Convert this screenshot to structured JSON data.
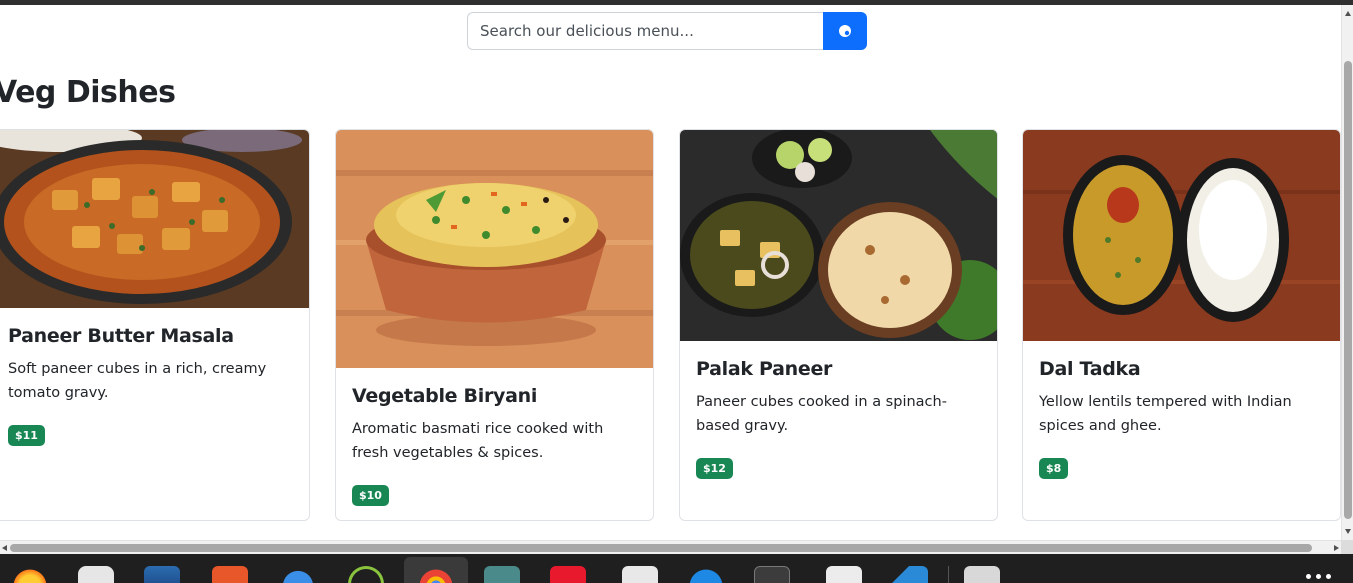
{
  "search": {
    "placeholder": "Search our delicious menu...",
    "button_icon": "search-icon"
  },
  "section": {
    "title": "Veg Dishes"
  },
  "dishes": [
    {
      "name": "Paneer Butter Masala",
      "description": "Soft paneer cubes in a rich, creamy tomato gravy.",
      "price": "$11",
      "image": "paneer-butter-masala-photo"
    },
    {
      "name": "Vegetable Biryani",
      "description": "Aromatic basmati rice cooked with fresh vegetables & spices.",
      "price": "$10",
      "image": "vegetable-biryani-photo"
    },
    {
      "name": "Palak Paneer",
      "description": "Paneer cubes cooked in a spinach-based gravy.",
      "price": "$12",
      "image": "palak-paneer-photo"
    },
    {
      "name": "Dal Tadka",
      "description": "Yellow lentils tempered with Indian spices and ghee.",
      "price": "$8",
      "image": "dal-tadka-photo"
    }
  ],
  "colors": {
    "primary": "#0d6efd",
    "price_badge": "#198754",
    "text": "#212529"
  },
  "taskbar": {
    "apps": [
      "firefox-icon",
      "system-monitor-icon",
      "text-editor-icon",
      "app-store-icon",
      "thunderbird-icon",
      "updater-icon",
      "chrome-icon",
      "files-icon",
      "red-app-icon",
      "document-viewer-icon",
      "help-icon",
      "terminal-icon",
      "notes-icon",
      "vscode-icon",
      "disk-icon"
    ],
    "more_icon": "app-grid-icon"
  }
}
